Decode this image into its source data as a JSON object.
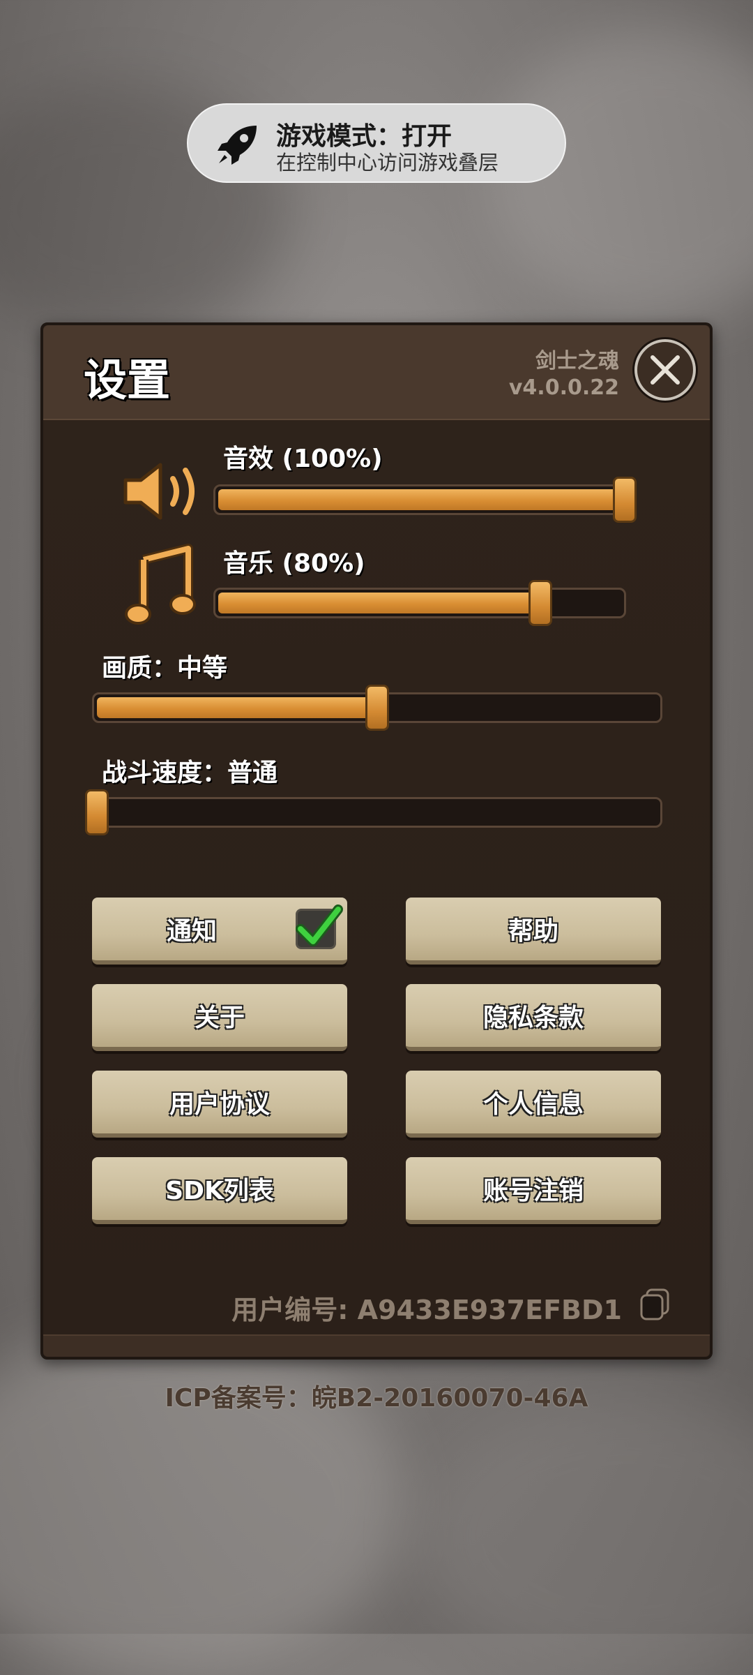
{
  "toast": {
    "icon": "rocket-icon",
    "title": "游戏模式：打开",
    "subtitle": "在控制中心访问游戏叠层"
  },
  "panel": {
    "title": "设置",
    "game_name": "剑士之魂",
    "version": "v4.0.0.22",
    "close_icon": "close-icon"
  },
  "sliders": {
    "sound_effects": {
      "label": "音效 (100%)",
      "value": 1.0,
      "icon": "speaker-icon"
    },
    "music": {
      "label": "音乐 (80%)",
      "value": 0.8,
      "icon": "music-note-icon"
    },
    "quality": {
      "label": "画质：中等",
      "value": 0.5
    },
    "battle_speed": {
      "label": "战斗速度：普通",
      "value": 0.0
    }
  },
  "buttons": {
    "notify": {
      "label": "通知",
      "checked": true
    },
    "help": {
      "label": "帮助"
    },
    "about": {
      "label": "关于"
    },
    "privacy": {
      "label": "隐私条款"
    },
    "user_agreement": {
      "label": "用户协议"
    },
    "personal_info": {
      "label": "个人信息"
    },
    "sdk_list": {
      "label": "SDK列表"
    },
    "account_cancel": {
      "label": "账号注销"
    }
  },
  "user_id": "用户编号: A9433E937EFBD1",
  "icp": "ICP备案号：皖B2-20160070-46A",
  "colors": {
    "panel_bg": "#3a2c22",
    "slider_fill": "#d98e33",
    "button_bg": "#cbbd9c",
    "check_green": "#3fd13f"
  }
}
